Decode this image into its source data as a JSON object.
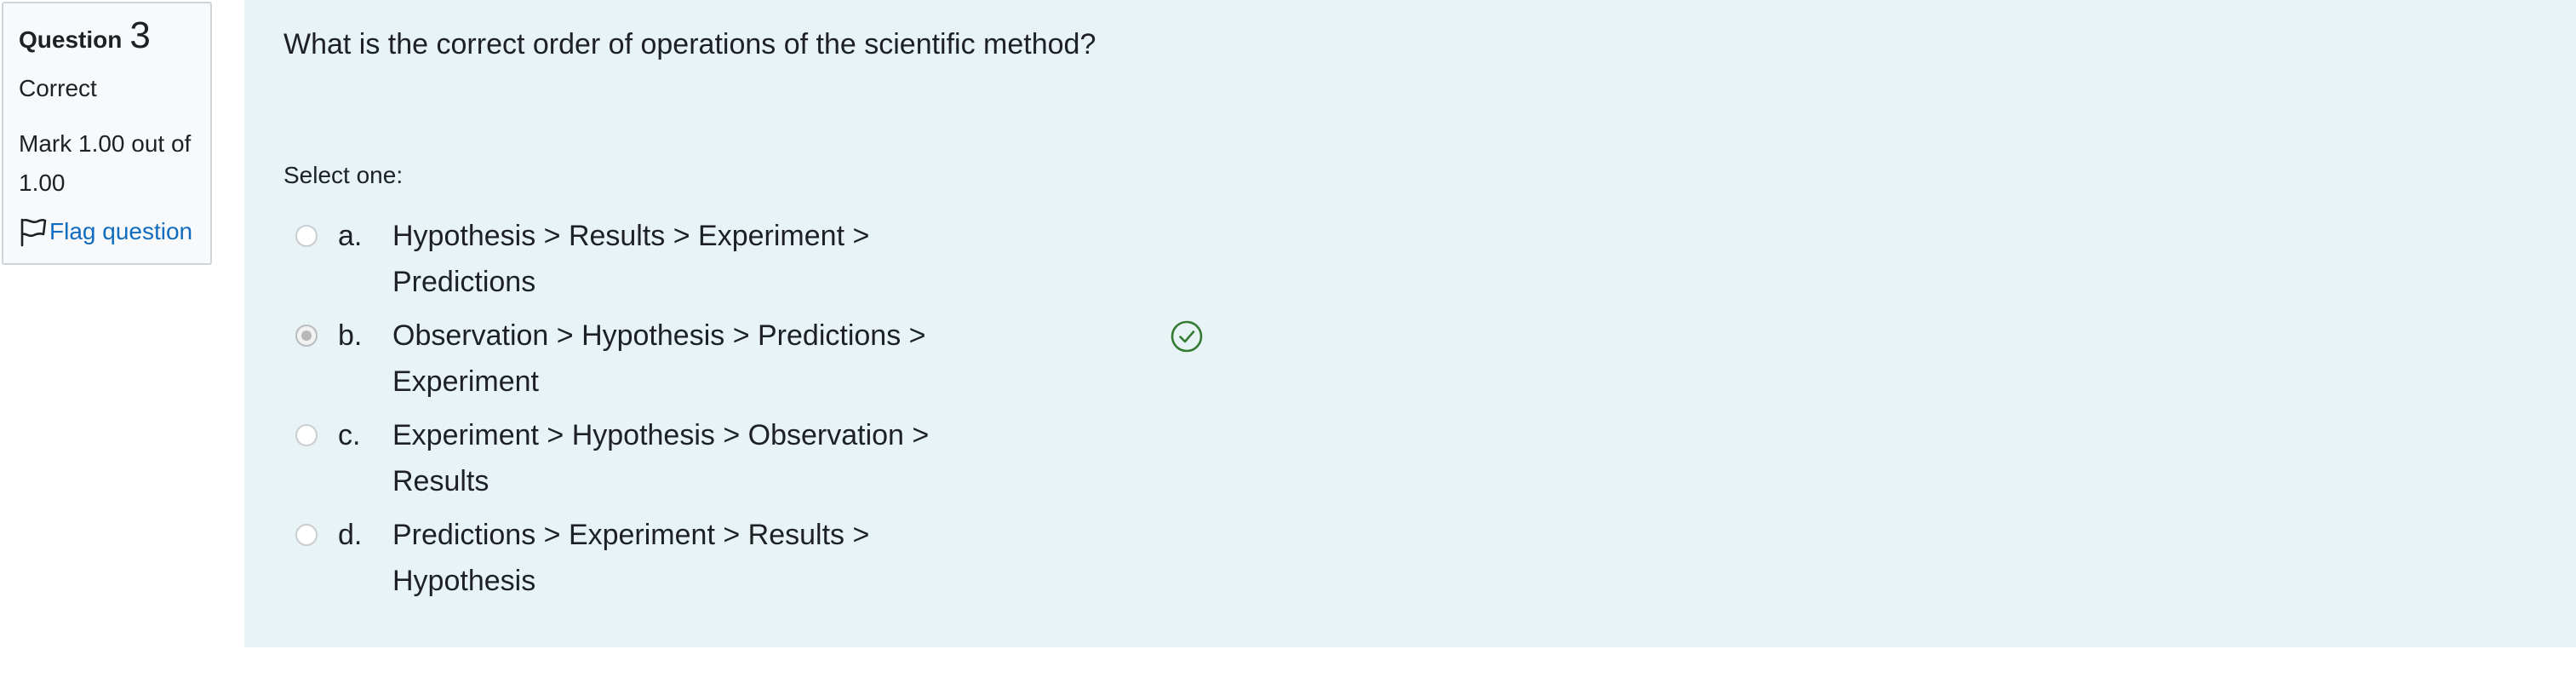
{
  "info": {
    "question_label": "Question",
    "question_number": "3",
    "state": "Correct",
    "grade": "Mark 1.00 out of 1.00",
    "flag_label": "Flag question"
  },
  "question": {
    "text": "What is the correct order of operations of the scientific method?",
    "prompt": "Select one:"
  },
  "answers": [
    {
      "letter": "a.",
      "text": "Hypothesis > Results > Experiment > Predictions",
      "selected": false
    },
    {
      "letter": "b.",
      "text": "Observation > Hypothesis > Predictions > Experiment",
      "selected": true,
      "feedback_icon": "check-circle-icon"
    },
    {
      "letter": "c.",
      "text": "Experiment > Hypothesis > Observation > Results",
      "selected": false
    },
    {
      "letter": "d.",
      "text": "Predictions > Experiment > Results > Hypothesis",
      "selected": false
    }
  ],
  "colors": {
    "info_background": "#f8f9fa",
    "content_background": "#e7f3f5",
    "link": "#0f6cbf",
    "correct": "#357a32"
  }
}
